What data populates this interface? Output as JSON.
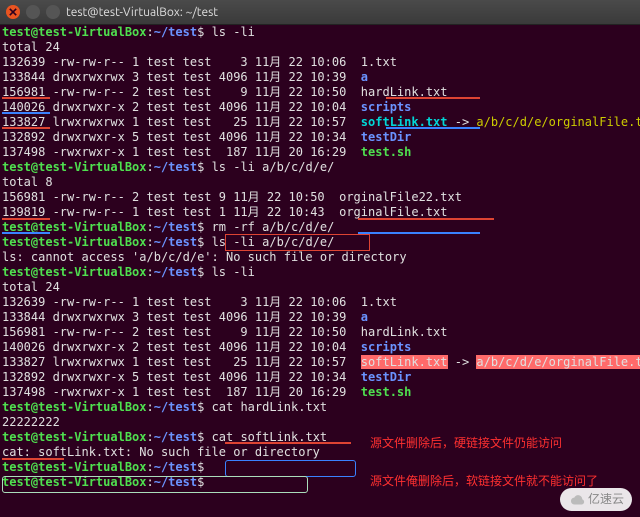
{
  "titlebar": {
    "title": "test@test-VirtualBox: ~/test"
  },
  "prompt": {
    "user_host": "test@test-VirtualBox",
    "sep": ":",
    "path": "~/test",
    "sigil": "$"
  },
  "commands": {
    "ls_li": "ls -li",
    "ls_li_path": "ls -li a/b/c/d/e/",
    "rm_rf": "rm -rf a/b/c/d/e/",
    "cat_hard": "cat hardLink.txt",
    "cat_soft": "cat softLink.txt"
  },
  "blocks": {
    "total24": "total 24",
    "total8": "total 8",
    "cat_hard_out": "22222222",
    "ls_err": "ls: cannot access 'a/b/c/d/e': No such file or directory",
    "cat_soft_err": "cat: softLink.txt: No such file or directory"
  },
  "ls1": [
    {
      "inode": "132639",
      "perm": "-rw-rw-r--",
      "l": "1",
      "u": "test",
      "g": "test",
      "sz": "   3",
      "mon": "11月",
      "d": "22",
      "t": "10:06",
      "name": "1.txt",
      "cls": "w"
    },
    {
      "inode": "133844",
      "perm": "drwxrwxrwx",
      "l": "3",
      "u": "test",
      "g": "test",
      "sz": "4096",
      "mon": "11月",
      "d": "22",
      "t": "10:39",
      "name": "a",
      "cls": "b"
    },
    {
      "inode": "156981",
      "perm": "-rw-rw-r--",
      "l": "2",
      "u": "test",
      "g": "test",
      "sz": "   9",
      "mon": "11月",
      "d": "22",
      "t": "10:50",
      "name": "hardLink.txt",
      "cls": "w"
    },
    {
      "inode": "140026",
      "perm": "drwxrwxr-x",
      "l": "2",
      "u": "test",
      "g": "test",
      "sz": "4096",
      "mon": "11月",
      "d": "22",
      "t": "10:04",
      "name": "scripts",
      "cls": "b"
    },
    {
      "inode": "133827",
      "perm": "lrwxrwxrwx",
      "l": "1",
      "u": "test",
      "g": "test",
      "sz": "  25",
      "mon": "11月",
      "d": "22",
      "t": "10:57",
      "name": "softLink.txt",
      "cls": "c",
      "arrow": " -> ",
      "target": "a/b/c/d/e/orginalFile.txt",
      "tcls": "y"
    },
    {
      "inode": "132892",
      "perm": "drwxrwxr-x",
      "l": "5",
      "u": "test",
      "g": "test",
      "sz": "4096",
      "mon": "11月",
      "d": "22",
      "t": "10:34",
      "name": "testDir",
      "cls": "b"
    },
    {
      "inode": "137498",
      "perm": "-rwxrwxr-x",
      "l": "1",
      "u": "test",
      "g": "test",
      "sz": " 187",
      "mon": "11月",
      "d": "20",
      "t": "16:29",
      "name": "test.sh",
      "cls": "g"
    }
  ],
  "ls2": [
    {
      "inode": "156981",
      "perm": "-rw-rw-r--",
      "l": "2",
      "u": "test",
      "g": "test",
      "sz": "9",
      "mon": "11月",
      "d": "22",
      "t": "10:50",
      "name": "orginalFile22.txt",
      "cls": "w"
    },
    {
      "inode": "139819",
      "perm": "-rw-rw-r--",
      "l": "1",
      "u": "test",
      "g": "test",
      "sz": "1",
      "mon": "11月",
      "d": "22",
      "t": "10:43",
      "name": "orginalFile.txt",
      "cls": "w"
    }
  ],
  "ls3": [
    {
      "inode": "132639",
      "perm": "-rw-rw-r--",
      "l": "1",
      "u": "test",
      "g": "test",
      "sz": "   3",
      "mon": "11月",
      "d": "22",
      "t": "10:06",
      "name": "1.txt",
      "cls": "w"
    },
    {
      "inode": "133844",
      "perm": "drwxrwxrwx",
      "l": "3",
      "u": "test",
      "g": "test",
      "sz": "4096",
      "mon": "11月",
      "d": "22",
      "t": "10:39",
      "name": "a",
      "cls": "b"
    },
    {
      "inode": "156981",
      "perm": "-rw-rw-r--",
      "l": "2",
      "u": "test",
      "g": "test",
      "sz": "   9",
      "mon": "11月",
      "d": "22",
      "t": "10:50",
      "name": "hardLink.txt",
      "cls": "w"
    },
    {
      "inode": "140026",
      "perm": "drwxrwxr-x",
      "l": "2",
      "u": "test",
      "g": "test",
      "sz": "4096",
      "mon": "11月",
      "d": "22",
      "t": "10:04",
      "name": "scripts",
      "cls": "b"
    },
    {
      "inode": "133827",
      "perm": "lrwxrwxrwx",
      "l": "1",
      "u": "test",
      "g": "test",
      "sz": "  25",
      "mon": "11月",
      "d": "22",
      "t": "10:57",
      "name": "softLink.txt",
      "cls": "hl",
      "arrow": " -> ",
      "target": "a/b/c/d/e/orginalFile.txt",
      "tcls": "hl"
    },
    {
      "inode": "132892",
      "perm": "drwxrwxr-x",
      "l": "5",
      "u": "test",
      "g": "test",
      "sz": "4096",
      "mon": "11月",
      "d": "22",
      "t": "10:34",
      "name": "testDir",
      "cls": "b"
    },
    {
      "inode": "137498",
      "perm": "-rwxrwxr-x",
      "l": "1",
      "u": "test",
      "g": "test",
      "sz": " 187",
      "mon": "11月",
      "d": "20",
      "t": "16:29",
      "name": "test.sh",
      "cls": "g"
    }
  ],
  "annotations": {
    "note1": "源文件删除后，硬链接文件仍能访问",
    "note2": "源文件俺删除后，软链接文件就不能访问了"
  },
  "brand": {
    "text": "亿速云"
  }
}
